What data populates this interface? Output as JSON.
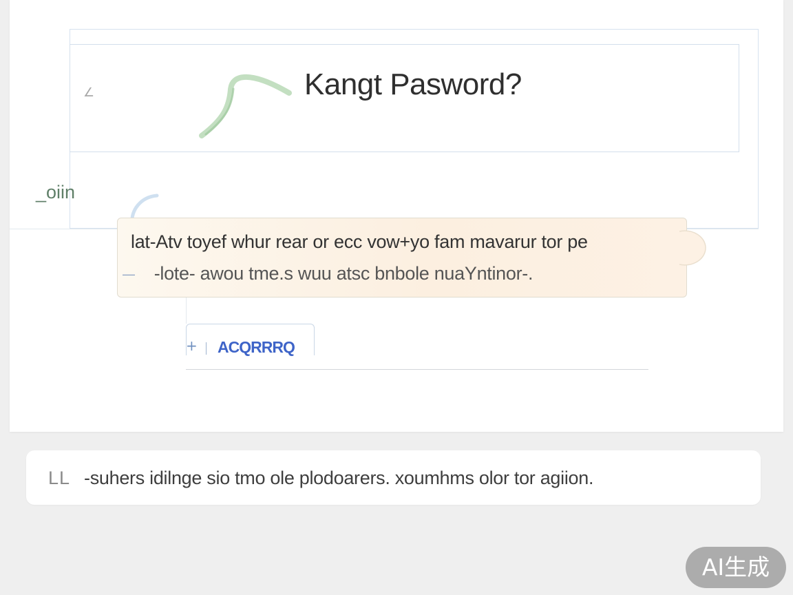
{
  "header": {
    "back_glyph": "∠",
    "title": "Kangt Pasword?"
  },
  "login": {
    "label": "_oiin"
  },
  "tooltip": {
    "line1": "lat-Atv toyef whur rear or ecc vow+yo fam mavarur tor pe",
    "line2_dash": "—",
    "line2": "-lote-  awou tme.s wuu atsc bnbole nuaYntinor-."
  },
  "code_field": {
    "plus_glyph": "+",
    "value": "ACQRRRQ"
  },
  "footer": {
    "icon_text": "LL",
    "text": "-suhers idilnge sio tmo ole plodoarers. xoumhms olor tor agiion."
  },
  "watermark": {
    "label": "AI生成"
  },
  "colors": {
    "accent_green": "#5f7f68",
    "accent_blue": "#3e64c8",
    "tooltip_bg": "#fcefe0",
    "page_bg": "#efefef"
  }
}
